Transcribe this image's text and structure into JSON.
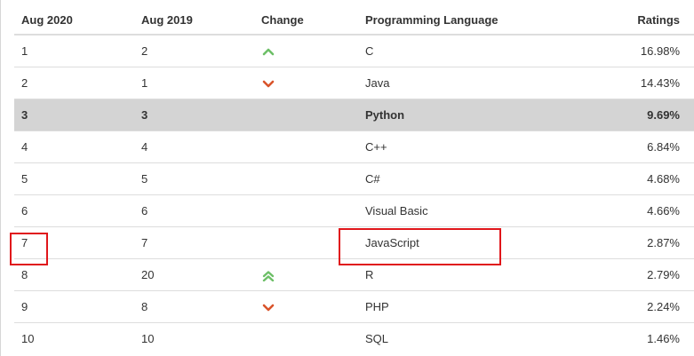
{
  "table": {
    "headers": {
      "rank_now": "Aug 2020",
      "rank_prev": "Aug 2019",
      "change": "Change",
      "language": "Programming Language",
      "ratings": "Ratings"
    },
    "rows": [
      {
        "rank_now": "1",
        "rank_prev": "2",
        "change": "up",
        "language": "C",
        "ratings": "16.98%"
      },
      {
        "rank_now": "2",
        "rank_prev": "1",
        "change": "down",
        "language": "Java",
        "ratings": "14.43%"
      },
      {
        "rank_now": "3",
        "rank_prev": "3",
        "change": "none",
        "language": "Python",
        "ratings": "9.69%"
      },
      {
        "rank_now": "4",
        "rank_prev": "4",
        "change": "none",
        "language": "C++",
        "ratings": "6.84%"
      },
      {
        "rank_now": "5",
        "rank_prev": "5",
        "change": "none",
        "language": "C#",
        "ratings": "4.68%"
      },
      {
        "rank_now": "6",
        "rank_prev": "6",
        "change": "none",
        "language": "Visual Basic",
        "ratings": "4.66%"
      },
      {
        "rank_now": "7",
        "rank_prev": "7",
        "change": "none",
        "language": "JavaScript",
        "ratings": "2.87%"
      },
      {
        "rank_now": "8",
        "rank_prev": "20",
        "change": "up-double",
        "language": "R",
        "ratings": "2.79%"
      },
      {
        "rank_now": "9",
        "rank_prev": "8",
        "change": "down",
        "language": "PHP",
        "ratings": "2.24%"
      },
      {
        "rank_now": "10",
        "rank_prev": "10",
        "change": "none",
        "language": "SQL",
        "ratings": "1.46%"
      }
    ],
    "highlighted_row_index": 2
  },
  "annotations": {
    "rank_box_row_index": 6,
    "language_box_row_index": 6,
    "box_color": "#e0161b"
  },
  "icons": {
    "up": "chevron-up-icon",
    "down": "chevron-down-icon",
    "up-double": "double-chevron-up-icon"
  },
  "colors": {
    "up": "#6dbf67",
    "down": "#d9542b",
    "highlight_row": "#d4d4d4",
    "row_border": "#dddddd"
  }
}
